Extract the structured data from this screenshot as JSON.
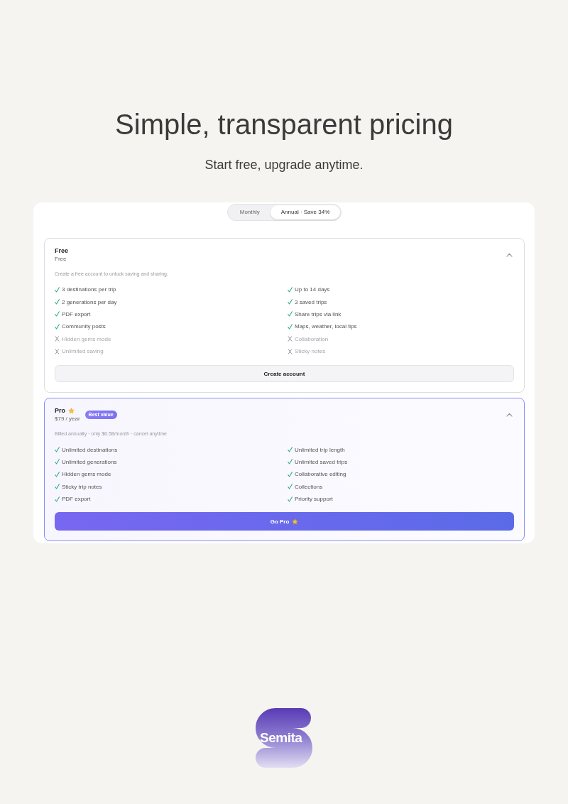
{
  "header": {
    "title": "Simple, transparent pricing",
    "subtitle": "Start free, upgrade anytime."
  },
  "billing_toggle": [
    {
      "label": "Monthly",
      "selected": false
    },
    {
      "label": "Annual · Save 34%",
      "selected": true
    }
  ],
  "plans": [
    {
      "name": "Free",
      "starred": false,
      "price": "Free",
      "highlighted": false,
      "expanded": true,
      "description": "Create a free account to unlock saving and sharing.",
      "features": [
        {
          "label": "3 destinations per trip",
          "included": true
        },
        {
          "label": "Up to 14 days",
          "included": true
        },
        {
          "label": "2 generations per day",
          "included": true
        },
        {
          "label": "3 saved trips",
          "included": true
        },
        {
          "label": "PDF export",
          "included": true
        },
        {
          "label": "Share trips via link",
          "included": true
        },
        {
          "label": "Community posts",
          "included": true
        },
        {
          "label": "Maps, weather, local tips",
          "included": true
        },
        {
          "label": "Hidden gems mode",
          "included": false
        },
        {
          "label": "Collaboration",
          "included": false
        },
        {
          "label": "Unlimited saving",
          "included": false
        },
        {
          "label": "Sticky notes",
          "included": false
        }
      ],
      "button": {
        "label": "Create account",
        "primary": false,
        "star": false
      }
    },
    {
      "name": "Pro",
      "starred": true,
      "price": "$79 / year",
      "badge": "Best value",
      "highlighted": true,
      "expanded": true,
      "description": "Billed annually · only $6.58/month · cancel anytime",
      "features": [
        {
          "label": "Unlimited destinations",
          "included": true
        },
        {
          "label": "Unlimited trip length",
          "included": true
        },
        {
          "label": "Unlimited generations",
          "included": true
        },
        {
          "label": "Unlimited saved trips",
          "included": true
        },
        {
          "label": "Hidden gems mode",
          "included": true
        },
        {
          "label": "Collaborative editing",
          "included": true
        },
        {
          "label": "Sticky trip notes",
          "included": true
        },
        {
          "label": "Collections",
          "included": true
        },
        {
          "label": "PDF export",
          "included": true
        },
        {
          "label": "Priority support",
          "included": true
        }
      ],
      "button": {
        "label": "Go Pro",
        "primary": true,
        "star": true
      }
    }
  ],
  "footer_logo": {
    "text": "Semita"
  }
}
